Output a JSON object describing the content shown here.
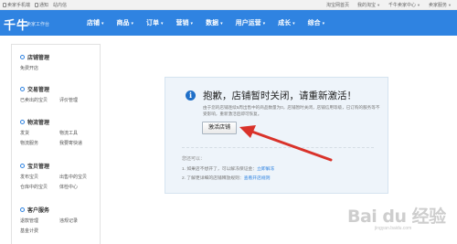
{
  "topbar": {
    "left_items": [
      "卖家手机端",
      "通知",
      "站内信"
    ],
    "right_items": [
      "淘宝网首页",
      "我的淘宝",
      "千牛卖家中心",
      "卖家服务"
    ]
  },
  "navbar": {
    "logo": "千牛",
    "logo_sub": "卖家工作台",
    "items": [
      "店铺",
      "商品",
      "订单",
      "营销",
      "数据",
      "用户运营",
      "成长",
      "综合"
    ]
  },
  "sidebar": {
    "sections": [
      {
        "title": "店铺管理",
        "icon": "store-icon",
        "links": [
          "免费开店"
        ]
      },
      {
        "title": "交易管理",
        "icon": "trade-icon",
        "links": [
          "已卖出的宝贝",
          "评价管理"
        ]
      },
      {
        "title": "物流管理",
        "icon": "logistics-icon",
        "links": [
          "发货",
          "物流工具",
          "物流服务",
          "我要寄快递"
        ]
      },
      {
        "title": "宝贝管理",
        "icon": "product-icon",
        "links": [
          "发布宝贝",
          "出售中的宝贝",
          "仓库中的宝贝",
          "体检中心"
        ]
      },
      {
        "title": "客户服务",
        "icon": "customer-service-icon",
        "links": [
          "退款管理",
          "违规记录",
          "基金计费"
        ]
      }
    ]
  },
  "notice": {
    "icon": "info-icon",
    "title": "抱歉，店铺暂时关闭，请重新激活！",
    "description": "由于您的店铺连续5周出售中的商品数量为0，店铺暂时关闭，店铺信用等级，已订购的服务等不受影响，重新激活后即可恢复。",
    "button_label": "激活店铺",
    "help_title": "您还可以：",
    "help_items": [
      {
        "text": "1. 如果店不想开了，可以解冻保证金：",
        "link": "立即解冻"
      },
      {
        "text": "2. 了解更详细的店铺释放规则：",
        "link": "查看开店规则"
      }
    ]
  },
  "watermark": {
    "logo": "Bai du 经验",
    "sub": "jingyan.baidu.com"
  },
  "colors": {
    "nav_blue": "#2f83e1",
    "arrow_red": "#d9322a",
    "notice_bg": "#eef4fa"
  }
}
